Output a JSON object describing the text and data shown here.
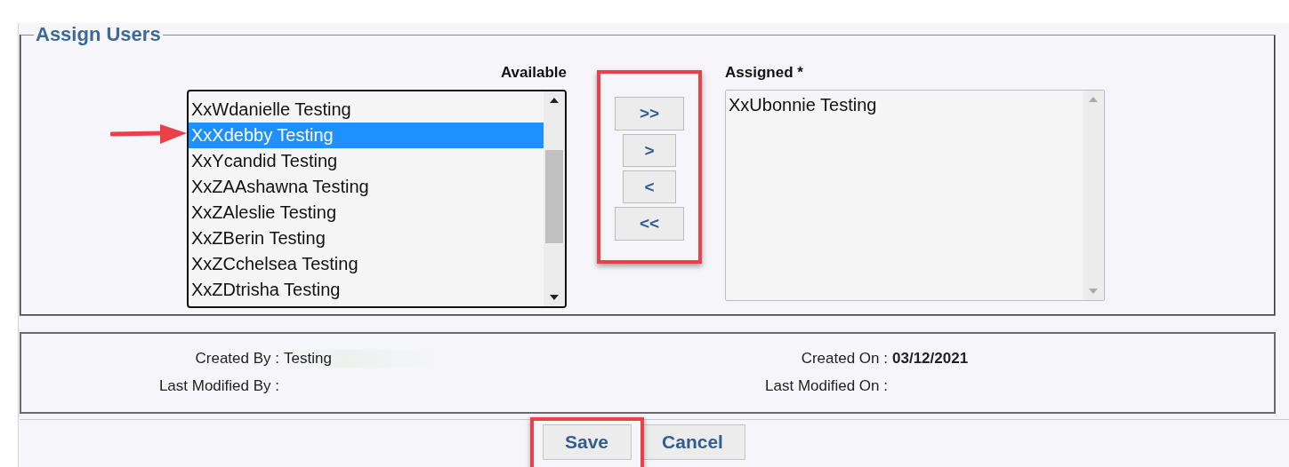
{
  "fieldset": {
    "legend": "Assign Users"
  },
  "available": {
    "label": "Available",
    "items": [
      {
        "text": "XxWdanielle Testing",
        "selected": false
      },
      {
        "text": "XxXdebby Testing",
        "selected": true
      },
      {
        "text": "XxYcandid Testing",
        "selected": false
      },
      {
        "text": "XxZAAshawna Testing",
        "selected": false
      },
      {
        "text": "XxZAleslie Testing",
        "selected": false
      },
      {
        "text": "XxZBerin Testing",
        "selected": false
      },
      {
        "text": "XxZCchelsea Testing",
        "selected": false
      },
      {
        "text": "XxZDtrisha Testing",
        "selected": false
      }
    ]
  },
  "move_buttons": [
    ">>",
    ">",
    "<",
    "<<"
  ],
  "assigned": {
    "label": "Assigned *",
    "items": [
      {
        "text": "XxUbonnie Testing",
        "selected": false
      }
    ]
  },
  "audit": {
    "created_by_label": "Created By :",
    "created_by": "Testing",
    "created_on_label": "Created On :",
    "created_on": "03/12/2021",
    "modified_by_label": "Last Modified By :",
    "modified_on_label": "Last Modified On :"
  },
  "buttons": [
    "Save",
    "Cancel"
  ]
}
